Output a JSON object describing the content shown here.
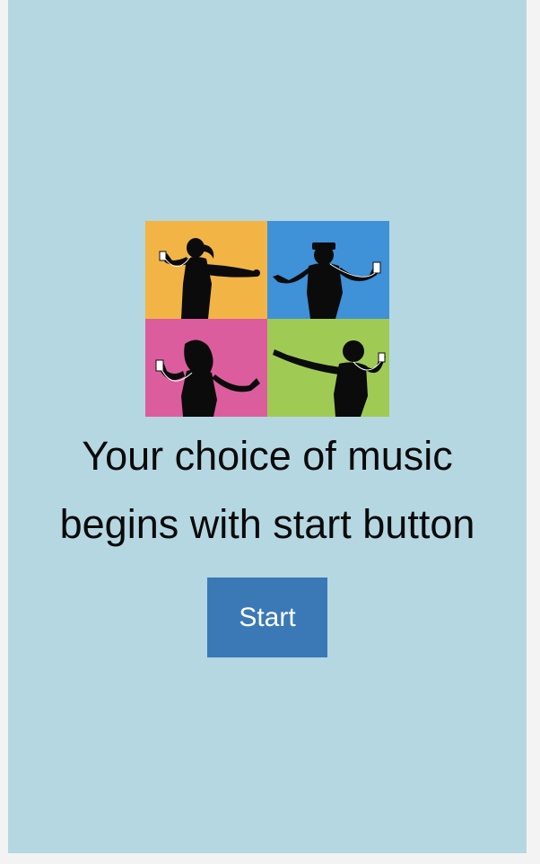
{
  "tagline": {
    "line1": "Your choice of music",
    "line2": "begins with start button"
  },
  "start_button": {
    "label": "Start"
  },
  "hero": {
    "icon": "dancing-silhouettes-image",
    "tile_colors": [
      "#f2b545",
      "#3f91d8",
      "#dc5d9e",
      "#9fcb55"
    ]
  },
  "colors": {
    "background": "#b5d7e2",
    "button": "#3b79b6",
    "button_text": "#ffffff",
    "text": "#0a0a0a"
  }
}
